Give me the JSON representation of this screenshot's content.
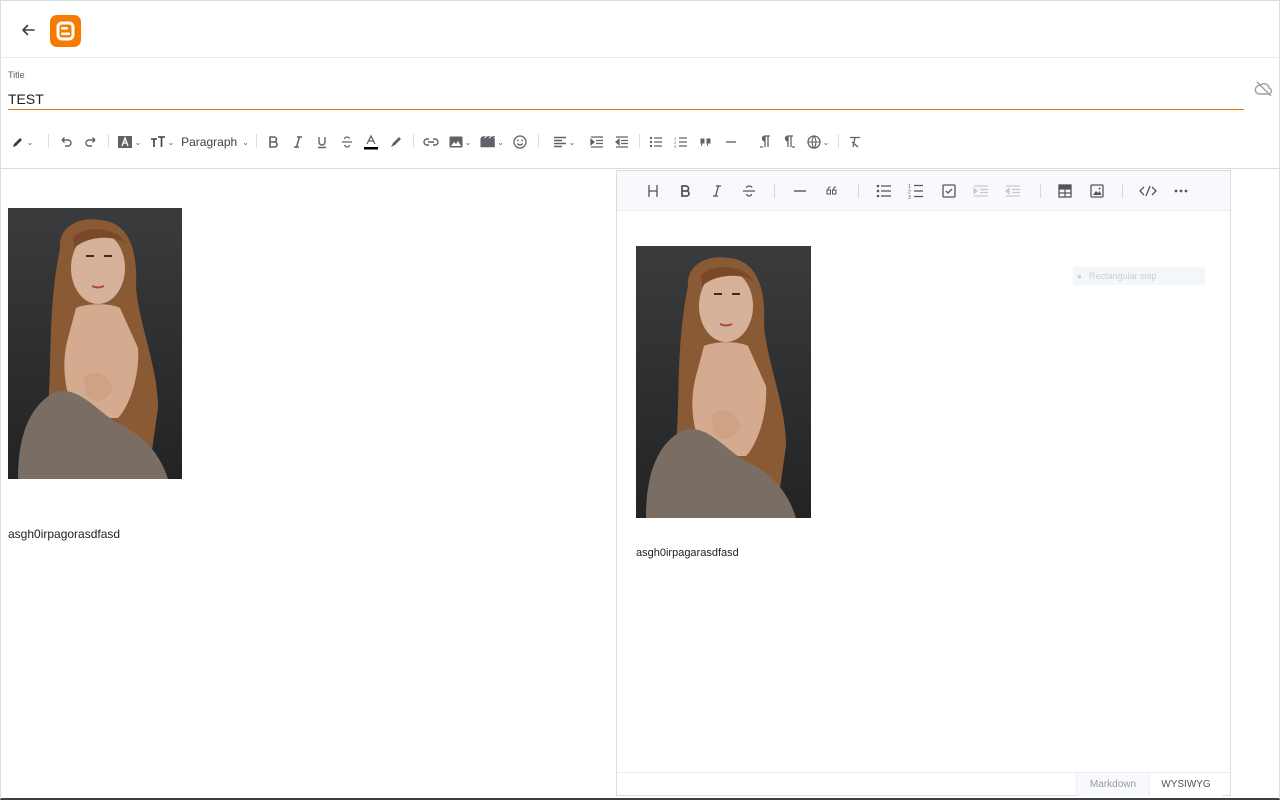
{
  "header": {
    "back_label": "Back",
    "logo_icon": "blogger-logo",
    "brand_color": "#f57c00"
  },
  "title_field": {
    "label": "Title",
    "value": "TEST"
  },
  "toolbar": {
    "paragraph_label": "Paragraph",
    "items": [
      "pencil-icon",
      "undo-icon",
      "redo-icon",
      "text-style-icon",
      "font-size-icon",
      "paragraph-select",
      "bold-icon",
      "italic-icon",
      "underline-icon",
      "strikethrough-icon",
      "text-color-icon",
      "highlight-icon",
      "link-icon",
      "image-icon",
      "video-icon",
      "emoji-icon",
      "align-icon",
      "indent-icon",
      "outdent-icon",
      "bullet-list-icon",
      "numbered-list-icon",
      "quote-icon",
      "horizontal-rule-icon",
      "ltr-icon",
      "rtl-icon",
      "language-icon",
      "clear-format-icon"
    ]
  },
  "left_view": {
    "body_text": "asgh0irpagorasdfasd"
  },
  "right_editor": {
    "body_text": "asgh0irpagarasdfasd",
    "alt_tooltip": "Rectangular snip",
    "tabs": {
      "markdown": "Markdown",
      "wysiwyg": "WYSIWYG"
    }
  },
  "colors": {
    "accent_underline": "#e8710a",
    "text_color_bar": "#000000"
  }
}
